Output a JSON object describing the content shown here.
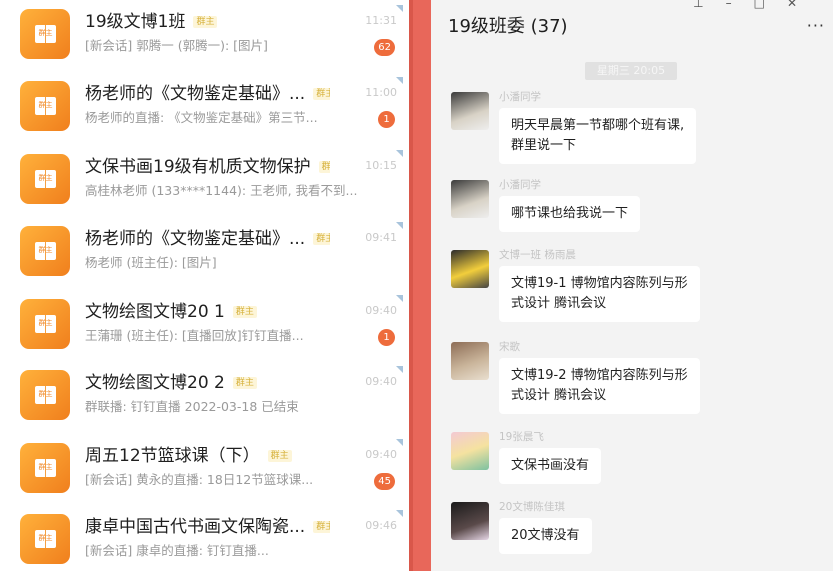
{
  "conversations": [
    {
      "title": "19级文博1班",
      "tag": "群主",
      "time": "11:31",
      "prefix": "",
      "preview": "[新会话] 郭腾一 (郭腾一): [图片]",
      "badge": "62"
    },
    {
      "title": "杨老师的《文物鉴定基础》...",
      "tag": "群主",
      "time": "11:00",
      "prefix": "",
      "preview": "杨老师的直播: 《文物鉴定基础》第三节...",
      "badge": "1"
    },
    {
      "title": "文保书画19级有机质文物保护",
      "tag": "群主",
      "time": "10:15",
      "prefix": "",
      "preview": "高桂林老师 (133****1144): 王老师, 我看不到...",
      "badge": ""
    },
    {
      "title": "杨老师的《文物鉴定基础》...",
      "tag": "群主",
      "time": "09:41",
      "prefix": "",
      "preview": "杨老师 (班主任): [图片]",
      "badge": ""
    },
    {
      "title": "文物绘图文博20 1",
      "tag": "群主",
      "time": "09:40",
      "prefix": "",
      "preview": "王蒲珊 (班主任): [直播回放]钉钉直播...",
      "badge": "1"
    },
    {
      "title": "文物绘图文博20 2",
      "tag": "群主",
      "time": "09:40",
      "prefix": "",
      "preview": "群联播: 钉钉直播 2022-03-18 已结束",
      "badge": ""
    },
    {
      "title": "周五12节篮球课（下）",
      "tag": "群主",
      "time": "09:40",
      "prefix": "",
      "preview": "[新会话] 黄永的直播: 18日12节篮球课...",
      "badge": "45"
    },
    {
      "title": "康卓中国古代书画文保陶瓷...",
      "tag": "群主",
      "time": "09:46",
      "prefix": "",
      "preview": "[新会话] 康卓的直播: 钉钉直播...",
      "badge": ""
    }
  ],
  "avatar_label": "群主",
  "chat": {
    "title": "19级班委 (37)",
    "date_divider": "星期三 20:05",
    "messages": [
      {
        "sender": "小潘同学",
        "text_lines": [
          "明天早晨第一节都哪个班有课,",
          "群里说一下"
        ]
      },
      {
        "sender": "小潘同学",
        "text_lines": [
          "哪节课也给我说一下"
        ]
      },
      {
        "sender": "文博一班 杨雨晨",
        "text_lines": [
          "文博19-1 博物馆内容陈列与形",
          "式设计 腾讯会议"
        ]
      },
      {
        "sender": "宋歌",
        "text_lines": [
          "文博19-2 博物馆内容陈列与形",
          "式设计 腾讯会议"
        ]
      },
      {
        "sender": "19张晨飞",
        "text_lines": [
          "文保书画没有"
        ]
      },
      {
        "sender": "20文博陈佳琪",
        "text_lines": [
          "20文博没有"
        ]
      }
    ]
  },
  "icons": {
    "pin": "pin-icon",
    "minimize": "minimize-icon",
    "maximize": "maximize-icon",
    "close": "close-icon",
    "more": "more-icon"
  },
  "colors": {
    "background": "#e8675a",
    "avatar_orange": "#f39a2c",
    "badge": "#ee6c3c",
    "new_session_prefix": "#e08b2c"
  }
}
